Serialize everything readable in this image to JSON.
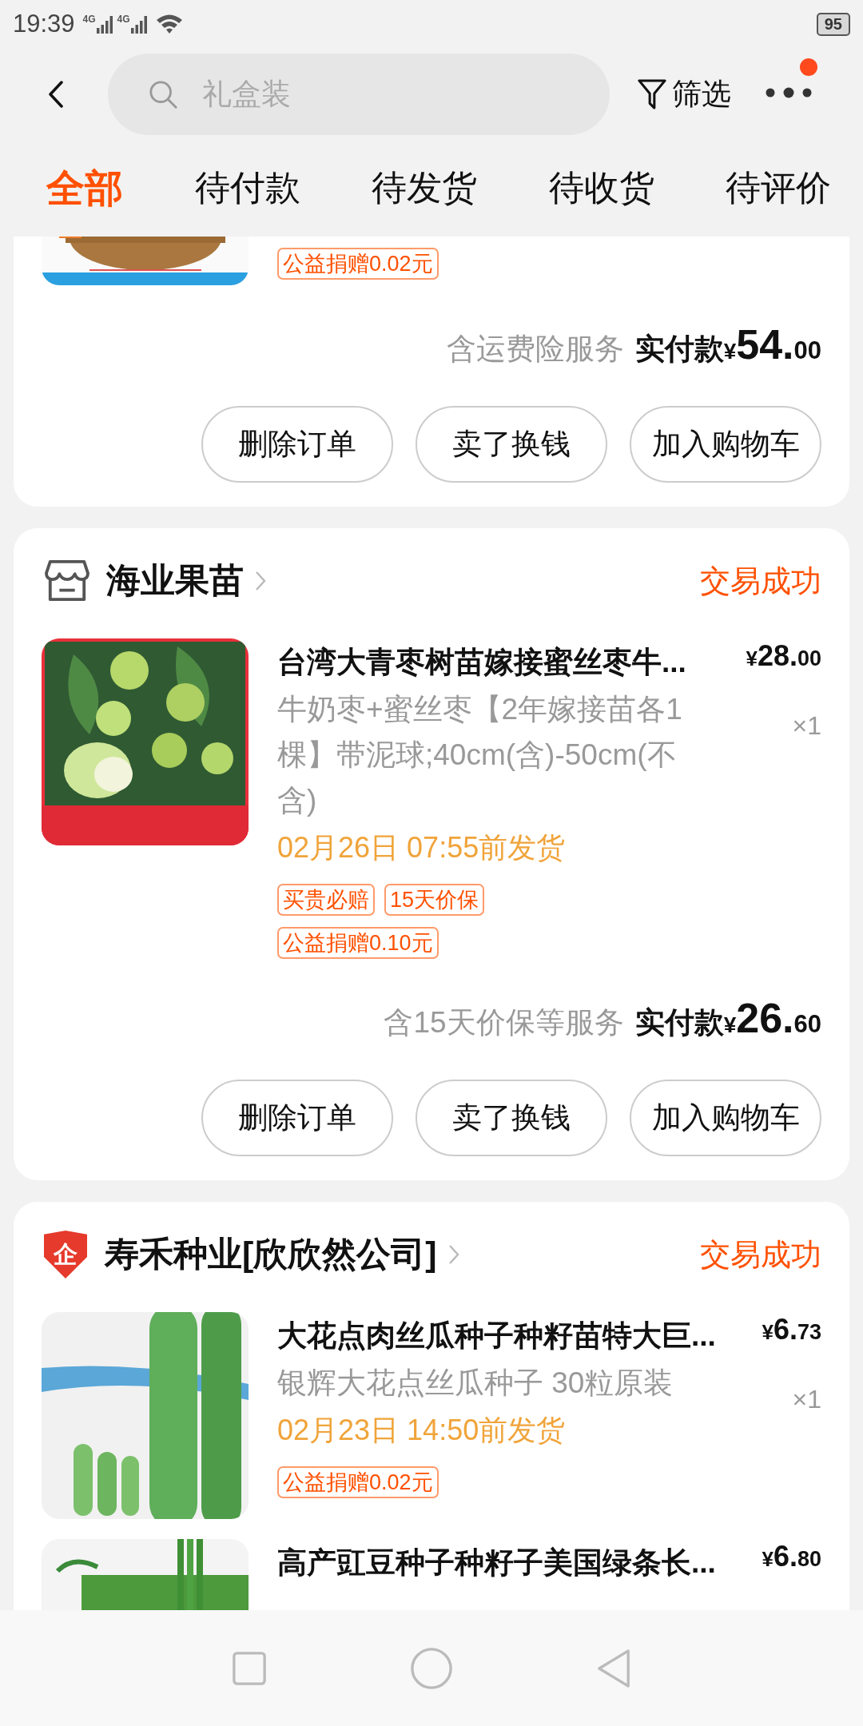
{
  "status_bar": {
    "time": "19:39",
    "signals": [
      "4G",
      "4G"
    ],
    "battery": "95"
  },
  "header": {
    "search_placeholder": "礼盒装",
    "filter": "筛选",
    "more_badge": true
  },
  "tabs": [
    {
      "label": "全部",
      "selected": true
    },
    {
      "label": "待付款",
      "selected": false
    },
    {
      "label": "待发货",
      "selected": false
    },
    {
      "label": "待收货",
      "selected": false
    },
    {
      "label": "待评价",
      "selected": false
    }
  ],
  "orders": [
    {
      "products": [
        {
          "tag_rows": [
            [
              "公益捐赠0.02元"
            ]
          ]
        }
      ],
      "service": "含运费险服务",
      "paid_label": "实付款",
      "paid": {
        "currency": "¥",
        "main": "54.",
        "cents": "00"
      },
      "buttons": [
        "删除订单",
        "卖了换钱",
        "加入购物车"
      ]
    },
    {
      "shop": {
        "kind": "store",
        "name": "海业果苗"
      },
      "status": "交易成功",
      "products": [
        {
          "title": "台湾大青枣树苗嫁接蜜丝枣牛...",
          "spec": "牛奶枣+蜜丝枣【2年嫁接苗各1棵】带泥球;40cm(含)-50cm(不含)",
          "price": {
            "currency": "¥",
            "main": "28.",
            "cents": "00"
          },
          "quantity": "×1",
          "ship_by": "02月26日 07:55前发货",
          "tag_rows": [
            [
              "买贵必赔",
              "15天价保"
            ],
            [
              "公益捐赠0.10元"
            ]
          ]
        }
      ],
      "service": "含15天价保等服务",
      "paid_label": "实付款",
      "paid": {
        "currency": "¥",
        "main": "26.",
        "cents": "60"
      },
      "buttons": [
        "删除订单",
        "卖了换钱",
        "加入购物车"
      ]
    },
    {
      "shop": {
        "kind": "enterprise",
        "name": "寿禾种业[欣欣然公司]",
        "badge": "企"
      },
      "status": "交易成功",
      "products": [
        {
          "title": "大花点肉丝瓜种子种籽苗特大巨...",
          "spec": "银辉大花点丝瓜种子 30粒原装",
          "price": {
            "currency": "¥",
            "main": "6.",
            "cents": "73"
          },
          "quantity": "×1",
          "ship_by": "02月23日 14:50前发货",
          "tag_rows": [
            [
              "公益捐赠0.02元"
            ]
          ]
        },
        {
          "title": "高产豇豆种子种籽子美国绿条长...",
          "price": {
            "currency": "¥",
            "main": "6.",
            "cents": "80"
          }
        }
      ]
    }
  ]
}
